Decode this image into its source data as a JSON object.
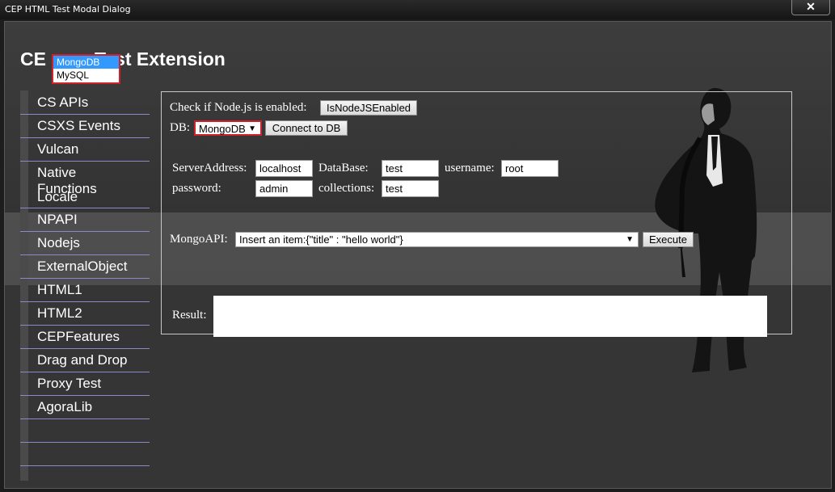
{
  "window": {
    "title": "CEP HTML Test Modal Dialog",
    "close": "✕"
  },
  "page": {
    "title_left": "CE",
    "title_right": "Test Extension"
  },
  "sidebar": {
    "items": [
      {
        "label": "CS APIs"
      },
      {
        "label": "CSXS Events"
      },
      {
        "label": "Vulcan"
      },
      {
        "label": "Native"
      },
      {
        "label": "Functions"
      },
      {
        "label": "Locale"
      },
      {
        "label": "NPAPI"
      },
      {
        "label": "Nodejs"
      },
      {
        "label": "ExternalObject"
      },
      {
        "label": "HTML1"
      },
      {
        "label": "HTML2"
      },
      {
        "label": "CEPFeatures"
      },
      {
        "label": "Drag and Drop"
      },
      {
        "label": "Proxy Test"
      },
      {
        "label": "AgoraLib"
      }
    ]
  },
  "main": {
    "node_check_label": "Check if Node.js is enabled:",
    "node_check_button": "IsNodeJSEnabled",
    "db_label": "DB:",
    "db_selected": "MongoDB",
    "connect_button": "Connect to DB",
    "server_address_label": "ServerAddress:",
    "server_address_value": "localhost",
    "database_label": "DataBase:",
    "database_value": "test",
    "username_label": "username:",
    "username_value": "root",
    "password_label": "password:",
    "password_value": "admin",
    "collections_label": "collections:",
    "collections_value": "test",
    "api_label": "MongoAPI:",
    "api_selected": "Insert an item:{\"title\" : \"hello world\"}",
    "execute_button": "Execute",
    "result_label": "Result:"
  },
  "db_dropdown": {
    "options": [
      "MongoDB",
      "MySQL"
    ],
    "highlighted": "MongoDB"
  },
  "colors": {
    "accent_red": "#d0202a",
    "highlight_blue": "#3399ff",
    "sidebar_divider": "#8a8ac8"
  }
}
